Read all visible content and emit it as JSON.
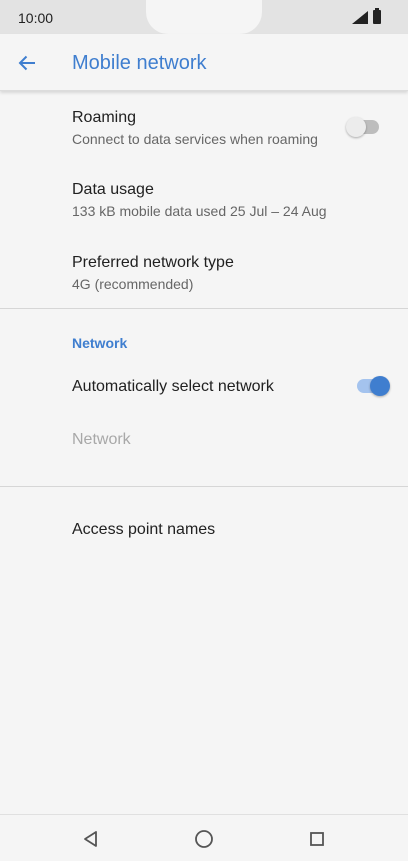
{
  "status_bar": {
    "time": "10:00",
    "icons": [
      "signal-icon",
      "battery-icon"
    ]
  },
  "app_bar": {
    "title": "Mobile network",
    "back_icon": "arrow-back-icon"
  },
  "settings": {
    "roaming": {
      "title": "Roaming",
      "summary": "Connect to data services when roaming",
      "enabled": false
    },
    "data_usage": {
      "title": "Data usage",
      "summary": "133 kB mobile data used 25 Jul – 24 Aug"
    },
    "preferred_network": {
      "title": "Preferred network type",
      "summary": "4G (recommended)"
    },
    "network_section": {
      "header": "Network"
    },
    "auto_select": {
      "title": "Automatically select network",
      "enabled": true
    },
    "network": {
      "title": "Network",
      "disabled": true
    },
    "apn": {
      "title": "Access point names"
    }
  },
  "nav_bar": {
    "buttons": [
      "back-triangle-icon",
      "home-circle-icon",
      "recents-square-icon"
    ]
  },
  "colors": {
    "accent": "#3f7ecf",
    "background": "#f5f5f5",
    "status_bar": "#e3e3e3"
  }
}
